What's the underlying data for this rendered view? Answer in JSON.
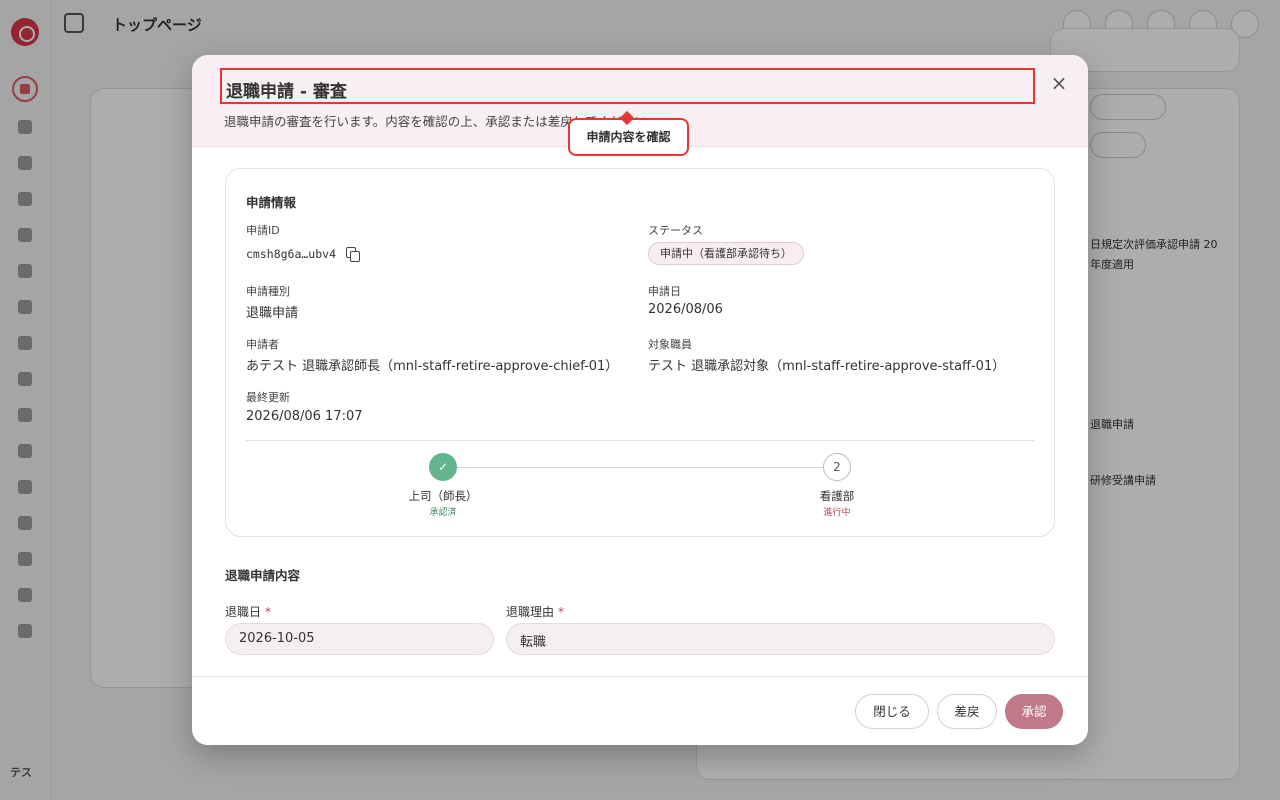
{
  "app": {
    "page_title": "トップページ",
    "sidebar_avatar": "テス",
    "background": {
      "rows": [
        "日規定次評価承認申請 20",
        "年度適用",
        "退職申請",
        "研修受講申請"
      ]
    }
  },
  "dialog": {
    "title": "退職申請 - 審査",
    "description": "退職申請の審査を行います。内容を確認の上、承認または差戻してください。",
    "tooltip": "申請内容を確認",
    "info_card": {
      "title": "申請情報",
      "request_id_label": "申請ID",
      "request_id": "cmsh8g6a…ubv4",
      "status_label": "ステータス",
      "status": "申請中（看護部承認待ち）",
      "type_label": "申請種別",
      "type": "退職申請",
      "date_label": "申請日",
      "date": "2026/08/06",
      "applicant_label": "申請者",
      "applicant": "あテスト 退職承認師長（mnl-staff-retire-approve-chief-01）",
      "target_label": "対象職員",
      "target": "テスト 退職承認対象（mnl-staff-retire-approve-staff-01）",
      "updated_label": "最終更新",
      "updated": "2026/08/06 17:07"
    },
    "steps": [
      {
        "number": "1",
        "label": "上司（師長）",
        "status": "承認済",
        "color": "#3a8a63"
      },
      {
        "number": "2",
        "label": "看護部",
        "status": "進行中",
        "color": "#c4455a"
      }
    ],
    "form": {
      "section_title": "退職申請内容",
      "retire_date_label": "退職日",
      "retire_date": "2026-10-05",
      "reason_label": "退職理由",
      "reason": "転職",
      "required_mark": "*"
    },
    "buttons": {
      "close": "閉じる",
      "return": "差戻",
      "approve": "承認"
    }
  }
}
